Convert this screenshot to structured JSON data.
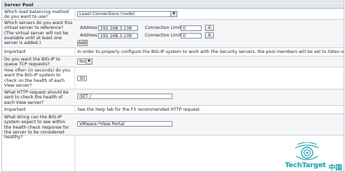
{
  "panel": {
    "title": "Server Pool"
  },
  "rows": {
    "lb_method": {
      "label": "Which load balancing method do you want to use?",
      "selected": "Least Connections (node)"
    },
    "servers": {
      "label": "Which servers do you want this virtual server to reference? (The virtual server will not be available until at least one server is added.)",
      "address_label": "Address",
      "conn_limit_label": "Connection Limit",
      "remove_label": "X",
      "add_label": "Add",
      "entries": [
        {
          "address": "192.168.3.138",
          "conn_limit": "0"
        },
        {
          "address": "192.168.3.139",
          "conn_limit": "0"
        }
      ]
    },
    "important1": {
      "label": "Important",
      "text": "In order to properly configure the BIG-IP system to work with the Security servers, the pool members will be set to listen on all ports."
    },
    "queue": {
      "label": "Do you want the BIG-IP to queue TCP requests?",
      "selected": "No"
    },
    "interval": {
      "label": "How often (in seconds) do you want the BIG-IP system to check on the health of each View server?",
      "value": "30"
    },
    "http_request": {
      "label": "What HTTP request should be sent to check the health of each View server?",
      "value": "GET /"
    },
    "important2": {
      "label": "Important",
      "text": "See the Help tab for the F5 recommended HTTP request."
    },
    "receive_string": {
      "label": "What string can the BIG-IP system expect to see within the health check response for the server to be considered healthy?",
      "value": "VMware.*View Portal"
    }
  },
  "watermark": {
    "brand": "TechTarget",
    "suffix": "中国"
  },
  "colors": {
    "border": "#b9c3cd",
    "brand": "#1b9bb2"
  }
}
